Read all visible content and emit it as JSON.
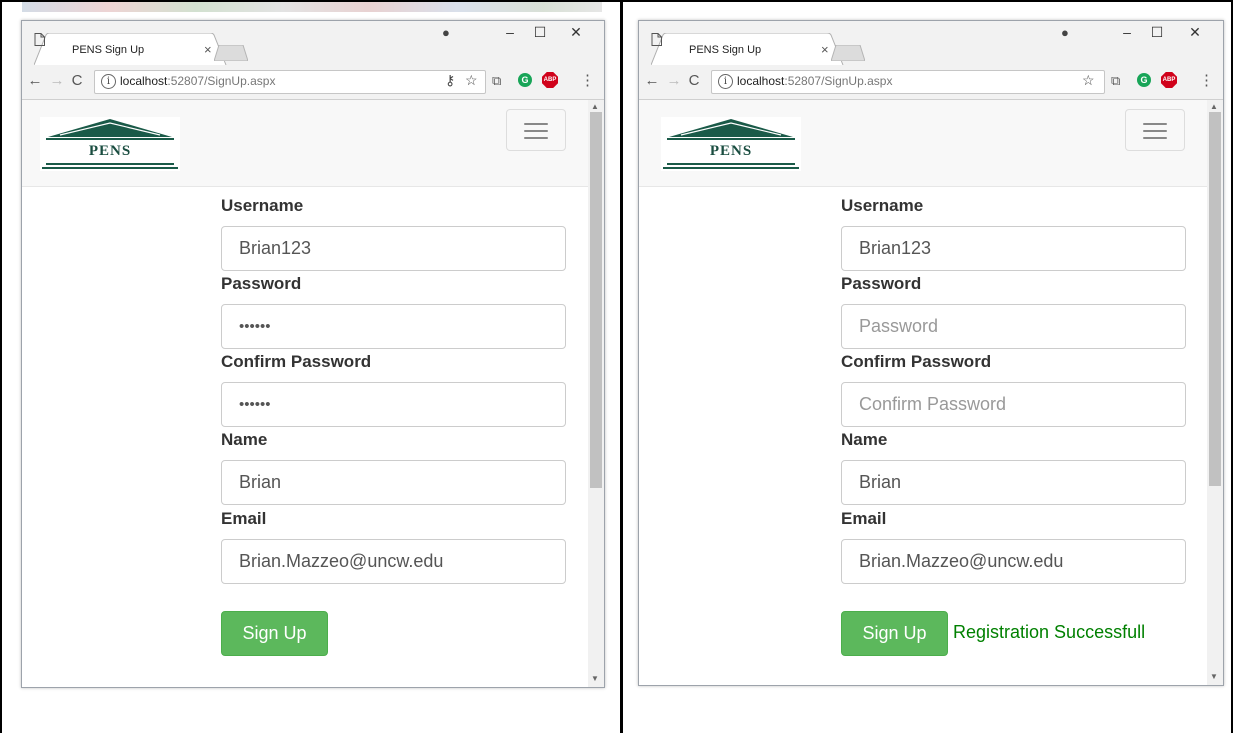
{
  "browsers": [
    {
      "id": "left",
      "tab_title": "PENS Sign Up",
      "url_host": "localhost",
      "url_path": ":52807/SignUp.aspx",
      "logo_text": "PENS",
      "form": {
        "username_label": "Username",
        "username_value": "Brian123",
        "password_label": "Password",
        "password_value": "••••••",
        "confirm_label": "Confirm Password",
        "confirm_value": "••••••",
        "name_label": "Name",
        "name_value": "Brian",
        "email_label": "Email",
        "email_value": "Brian.Mazzeo@uncw.edu",
        "signup_label": "Sign Up",
        "status_text": ""
      }
    },
    {
      "id": "right",
      "tab_title": "PENS Sign Up",
      "url_host": "localhost",
      "url_path": ":52807/SignUp.aspx",
      "logo_text": "PENS",
      "form": {
        "username_label": "Username",
        "username_value": "Brian123",
        "password_label": "Password",
        "password_placeholder": "Password",
        "confirm_label": "Confirm Password",
        "confirm_placeholder": "Confirm Password",
        "name_label": "Name",
        "name_value": "Brian",
        "email_label": "Email",
        "email_value": "Brian.Mazzeo@uncw.edu",
        "signup_label": "Sign Up",
        "status_text": "Registration Successfull"
      }
    }
  ],
  "colors": {
    "success_button": "#5cb85c",
    "success_text": "#008000",
    "logo_green": "#1a4d40"
  }
}
